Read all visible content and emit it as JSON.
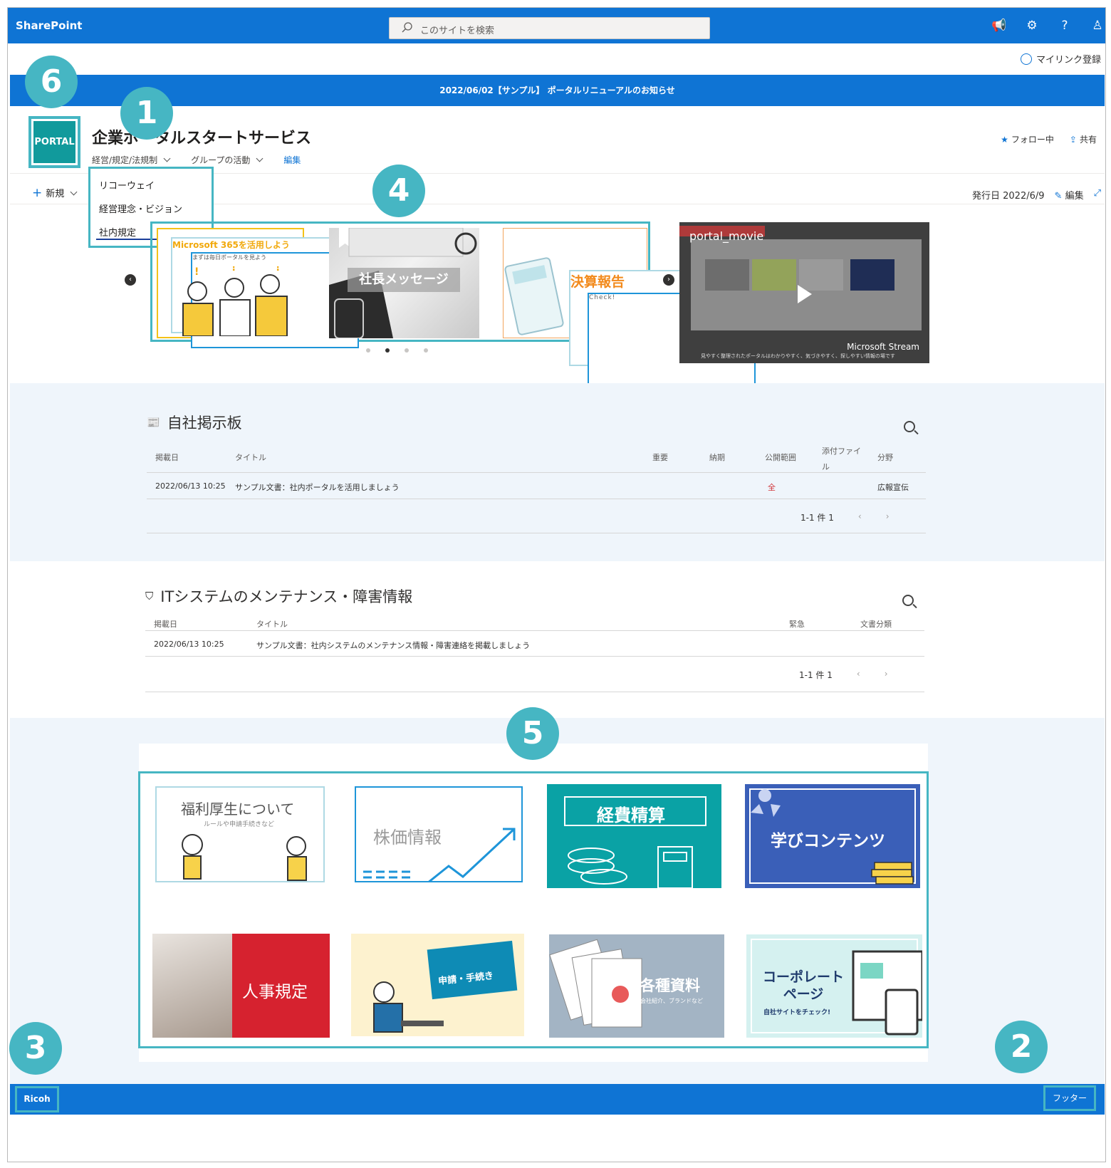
{
  "suitebar": {
    "brand": "SharePoint",
    "search_placeholder": "このサイトを検索"
  },
  "mylink": "マイリンク登録",
  "banner": "2022/06/02【サンプル】 ポータルリニューアルのお知らせ",
  "site": {
    "logo_text": "PORTAL",
    "title": "企業ポータルスタートサービス",
    "nav": [
      "経営/規定/法規制",
      "グループの活動"
    ],
    "nav_edit": "編集",
    "follow": "フォロー中",
    "share": "共有"
  },
  "dropdown": [
    "リコーウェイ",
    "経営理念・ビジョン",
    "社内規定"
  ],
  "commandbar": {
    "new": "新規",
    "published": "発行日 2022/6/9",
    "edit": "編集"
  },
  "carousel": {
    "slides": [
      {
        "title": "Microsoft 365を活用しよう",
        "subtitle": "まずは毎日ポータルを見よう"
      },
      {
        "title": "社長メッセージ"
      },
      {
        "title": "決算報告",
        "subtitle": "Check!"
      }
    ],
    "dot_count": 4,
    "active_index": 1
  },
  "video": {
    "title": "portal_movie",
    "brand": "Microsoft Stream",
    "caption": "見やすく整理されたポータルはわかりやすく、気づきやすく、探しやすい情報の場です"
  },
  "board": {
    "title": "自社掲示板",
    "headers": [
      "掲載日",
      "タイトル",
      "重要",
      "納期",
      "公開範囲",
      "添付ファイル",
      "分野"
    ],
    "rows": [
      {
        "date": "2022/06/13 10:25",
        "title": "サンプル文書：社内ポータルを活用しましょう",
        "scope": "全",
        "field": "広報宣伝"
      }
    ],
    "pager": "1-1 件 1"
  },
  "it": {
    "title": "ITシステムのメンテナンス・障害情報",
    "headers": [
      "掲載日",
      "タイトル",
      "緊急",
      "文書分類"
    ],
    "rows": [
      {
        "date": "2022/06/13 10:25",
        "title": "サンプル文書：社内システムのメンテナンス情報・障害連絡を掲載しましょう"
      }
    ],
    "pager": "1-1 件 1"
  },
  "quicklinks": [
    {
      "title": "福利厚生について",
      "subtitle": "ルールや申請手続きなど"
    },
    {
      "title": "株価情報"
    },
    {
      "title": "経費精算"
    },
    {
      "title": "学びコンテンツ"
    },
    {
      "title": "人事規定"
    },
    {
      "title": "申請・手続き"
    },
    {
      "title": "各種資料",
      "subtitle": "会社紹介、ブランドなど"
    },
    {
      "title": "コーポレートページ",
      "subtitle": "自社サイトをチェック!"
    }
  ],
  "footer": {
    "left": "Ricoh",
    "right": "フッター"
  },
  "callouts": [
    "6",
    "1",
    "4",
    "5",
    "3",
    "2"
  ],
  "colors": {
    "brand_blue": "#0f74d4",
    "callout_teal": "#46b6c3",
    "section_bg": "#eff5fb"
  }
}
